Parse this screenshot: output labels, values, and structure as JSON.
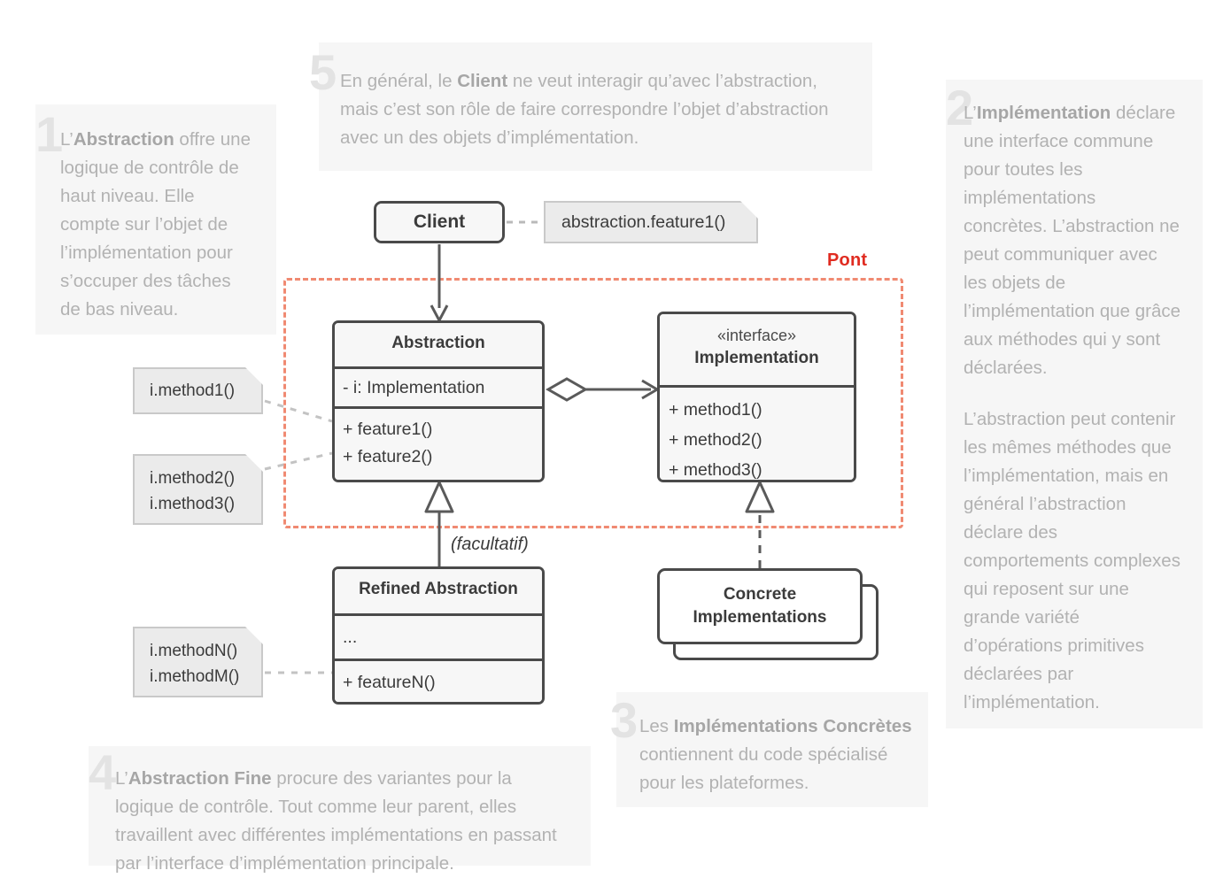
{
  "diagram": {
    "title": "Bridge design pattern (Pont) UML class diagram",
    "bridge_label": "Pont",
    "optional_label": "(facultatif)",
    "colors": {
      "bridge_accent": "#f08a72",
      "bridge_label_text": "#e02b20",
      "box_border": "#4a4a4a",
      "box_fill": "#f7f7f7",
      "note_fill": "#ebebeb",
      "note_border": "#c9c9c9",
      "callout_bg": "#f6f6f6",
      "callout_text": "#b2b2b2",
      "callout_number": "#e3e3e3"
    },
    "boxes": {
      "client": {
        "title": "Client"
      },
      "abstraction": {
        "title": "Abstraction",
        "attributes": [
          "- i: Implementation"
        ],
        "methods": [
          "+ feature1()",
          "+ feature2()"
        ]
      },
      "implementation": {
        "stereotype": "«interface»",
        "title": "Implementation",
        "methods": [
          "+ method1()",
          "+ method2()",
          "+ method3()"
        ]
      },
      "refined_abstraction": {
        "title": "Refined Abstraction",
        "attributes": [
          "..."
        ],
        "methods": [
          "+ featureN()"
        ]
      },
      "concrete_implementations": {
        "title_line1": "Concrete",
        "title_line2": "Implementations"
      }
    },
    "notes": {
      "client_call": "abstraction.feature1()",
      "method1": "i.method1()",
      "method23_line1": "i.method2()",
      "method23_line2": "i.method3()",
      "methodNM_line1": "i.methodN()",
      "methodNM_line2": "i.methodM()"
    }
  },
  "callouts": [
    {
      "number": "1",
      "lead": "L’",
      "bold": "Abstraction",
      "rest": " offre une logique de contrôle de haut niveau. Elle compte sur l’objet de l’implémentation pour s’occuper des tâches de bas niveau."
    },
    {
      "number": "2",
      "lead": "L’",
      "bold": "Implémentation",
      "rest": " déclare une interface commune pour toutes les implémentations concrètes. L’abstraction ne peut communiquer avec les objets de l’implémentation que grâce aux méthodes qui y sont déclarées.",
      "paragraph2": "L’abstraction peut contenir les mêmes méthodes que l’implémentation, mais en général l’abstraction déclare des comportements complexes qui reposent sur une grande variété d’opérations primitives déclarées par l’implémentation."
    },
    {
      "number": "3",
      "lead": "Les ",
      "bold": "Implémentations Concrètes",
      "rest": " contiennent du code spécialisé pour les plateformes."
    },
    {
      "number": "4",
      "lead": "L’",
      "bold": "Abstraction Fine",
      "rest": " procure des variantes pour la logique de contrôle. Tout comme leur parent, elles travaillent avec différentes implémentations en passant par l’interface d’implémentation principale."
    },
    {
      "number": "5",
      "lead": "En général, le ",
      "bold": "Client",
      "rest": " ne veut interagir qu’avec l’abstraction, mais c’est son rôle de faire correspondre l’objet d’abstraction avec un des objets d’implémentation."
    }
  ]
}
